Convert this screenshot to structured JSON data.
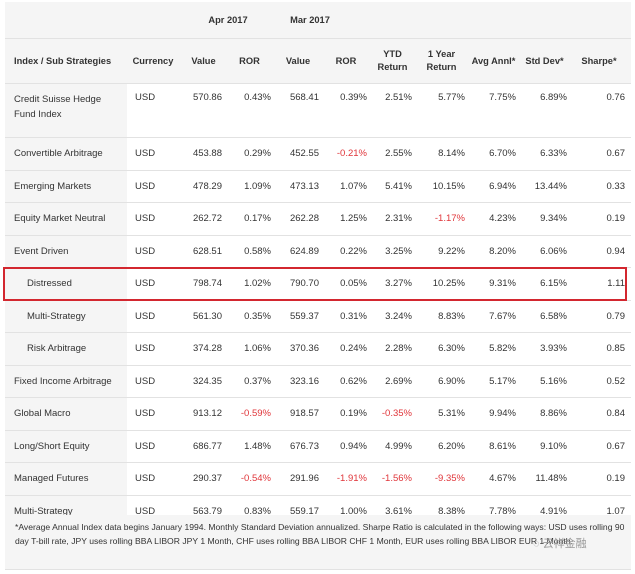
{
  "header": {
    "period1": "Apr 2017",
    "period2": "Mar 2017",
    "columns": [
      "Index / Sub Strategies",
      "Currency",
      "Value",
      "ROR",
      "Value",
      "ROR",
      "YTD Return",
      "1 Year Return",
      "Avg Annl*",
      "Std Dev*",
      "Sharpe*"
    ]
  },
  "rows": [
    {
      "name": "Credit Suisse Hedge Fund Index",
      "sub": false,
      "cells": [
        "USD",
        "570.86",
        "0.43%",
        "568.41",
        "0.39%",
        "2.51%",
        "5.77%",
        "7.75%",
        "6.89%",
        "0.76"
      ]
    },
    {
      "name": "Convertible Arbitrage",
      "sub": false,
      "cells": [
        "USD",
        "453.88",
        "0.29%",
        "452.55",
        "-0.21%",
        "2.55%",
        "8.14%",
        "6.70%",
        "6.33%",
        "0.67"
      ]
    },
    {
      "name": "Emerging Markets",
      "sub": false,
      "cells": [
        "USD",
        "478.29",
        "1.09%",
        "473.13",
        "1.07%",
        "5.41%",
        "10.15%",
        "6.94%",
        "13.44%",
        "0.33"
      ]
    },
    {
      "name": "Equity Market Neutral",
      "sub": false,
      "cells": [
        "USD",
        "262.72",
        "0.17%",
        "262.28",
        "1.25%",
        "2.31%",
        "-1.17%",
        "4.23%",
        "9.34%",
        "0.19"
      ]
    },
    {
      "name": "Event Driven",
      "sub": false,
      "cells": [
        "USD",
        "628.51",
        "0.58%",
        "624.89",
        "0.22%",
        "3.25%",
        "9.22%",
        "8.20%",
        "6.06%",
        "0.94"
      ]
    },
    {
      "name": "Distressed",
      "sub": true,
      "highlighted": true,
      "cells": [
        "USD",
        "798.74",
        "1.02%",
        "790.70",
        "0.05%",
        "3.27%",
        "10.25%",
        "9.31%",
        "6.15%",
        "1.11"
      ]
    },
    {
      "name": "Multi-Strategy",
      "sub": true,
      "cells": [
        "USD",
        "561.30",
        "0.35%",
        "559.37",
        "0.31%",
        "3.24%",
        "8.83%",
        "7.67%",
        "6.58%",
        "0.79"
      ]
    },
    {
      "name": "Risk Arbitrage",
      "sub": true,
      "cells": [
        "USD",
        "374.28",
        "1.06%",
        "370.36",
        "0.24%",
        "2.28%",
        "6.30%",
        "5.82%",
        "3.93%",
        "0.85"
      ]
    },
    {
      "name": "Fixed Income Arbitrage",
      "sub": false,
      "cells": [
        "USD",
        "324.35",
        "0.37%",
        "323.16",
        "0.62%",
        "2.69%",
        "6.90%",
        "5.17%",
        "5.16%",
        "0.52"
      ]
    },
    {
      "name": "Global Macro",
      "sub": false,
      "cells": [
        "USD",
        "913.12",
        "-0.59%",
        "918.57",
        "0.19%",
        "-0.35%",
        "5.31%",
        "9.94%",
        "8.86%",
        "0.84"
      ]
    },
    {
      "name": "Long/Short Equity",
      "sub": false,
      "cells": [
        "USD",
        "686.77",
        "1.48%",
        "676.73",
        "0.94%",
        "4.99%",
        "6.20%",
        "8.61%",
        "9.10%",
        "0.67"
      ]
    },
    {
      "name": "Managed Futures",
      "sub": false,
      "cells": [
        "USD",
        "290.37",
        "-0.54%",
        "291.96",
        "-1.91%",
        "-1.56%",
        "-9.35%",
        "4.67%",
        "11.48%",
        "0.19"
      ]
    },
    {
      "name": "Multi-Strategy",
      "sub": false,
      "cells": [
        "USD",
        "563.79",
        "0.83%",
        "559.17",
        "1.00%",
        "3.61%",
        "8.38%",
        "7.78%",
        "4.91%",
        "1.07"
      ]
    }
  ],
  "footnote": "*Average Annual Index data begins January 1994. Monthly Standard Deviation annualized. Sharpe Ratio is calculated in the following ways: USD uses rolling 90 day T-bill rate, JPY uses rolling BBA LIBOR JPY 1 Month, CHF uses rolling BBA LIBOR CHF 1 Month, EUR uses rolling BBA LIBOR EUR 1 Month.",
  "watermark": "云祥金融",
  "colors": {
    "negative": "#e0353a",
    "highlight_border": "#d3272f",
    "header_bg": "#f5f5f5"
  }
}
